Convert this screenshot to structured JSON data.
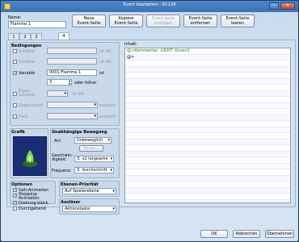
{
  "window": {
    "title": "Event bearbeiten - ID:128"
  },
  "name": {
    "label": "Name:",
    "value": "Flamme 1"
  },
  "toolbar": [
    {
      "label": "Neue\nEvent-Seite",
      "enabled": true
    },
    {
      "label": "Kopiere\nEvent-Seite",
      "enabled": true
    },
    {
      "label": "Event-Seite\neinfügen",
      "enabled": false
    },
    {
      "label": "Event-Seite\nentfernen",
      "enabled": true
    },
    {
      "label": "Event-Seite\nleeren",
      "enabled": true
    }
  ],
  "tabs": [
    "1",
    "2",
    "3",
    "4"
  ],
  "bedingungen": {
    "title": "Bedingungen",
    "schalter1": {
      "label": "Schalter",
      "suffix": "ist AN"
    },
    "schalter2": {
      "label": "Schalter",
      "suffix": "ist AN"
    },
    "variable": {
      "label": "Variable",
      "value": "0001:Flamme 1",
      "suffix": "ist",
      "number": "3",
      "compare": "oder höher"
    },
    "eigen": {
      "label": "Eigen-\nSchalter",
      "suffix": "ist AN"
    },
    "gegenstand": {
      "label": "Gegenstand",
      "suffix": "existiert"
    },
    "held": {
      "label": "Held",
      "suffix": "existiert"
    }
  },
  "grafik": {
    "title": "Grafik"
  },
  "bewegung": {
    "title": "Unabhängige Bewegung",
    "art_label": "Art:",
    "art_value": "Unbeweglich",
    "route_button": "Route...",
    "gesch_label": "Geschwin-\ndigkeit:",
    "gesch_value": "3: x2 langsame",
    "freq_label": "Frequenz:",
    "freq_value": "3: durchschnitt"
  },
  "optionen": {
    "title": "Optionen",
    "items": [
      {
        "label": "Geh-Animation",
        "checked": true
      },
      {
        "label": "Stepping-\nAnimation",
        "checked": true
      },
      {
        "label": "Drehung block.",
        "checked": true
      },
      {
        "label": "Durchgehend",
        "checked": false
      }
    ]
  },
  "prioritaet": {
    "title": "Ebenen-Priorität",
    "value": "Auf Spielerebene"
  },
  "ausloeser": {
    "title": "Auslöser",
    "value": "Aktionstaste"
  },
  "inhalt": {
    "label": "Inhalt:",
    "lines": [
      {
        "text": "@>Kommentar: LIGHT: Gruen1",
        "comment": true
      },
      {
        "text": "@>",
        "comment": false
      }
    ]
  },
  "footer": {
    "ok": "OK",
    "cancel": "Abbrechen",
    "apply": "Übernehmen"
  },
  "colors": {
    "comment": "#1a7a1a",
    "title_bar": "#3c73b6"
  }
}
